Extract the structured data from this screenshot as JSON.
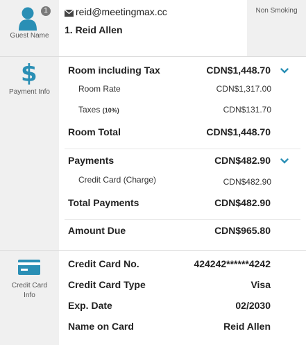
{
  "guest": {
    "section_label": "Guest Name",
    "badge_count": "1",
    "email": "reid@meetingmax.cc",
    "name_line": "1. Reid Allen",
    "preference": "Non Smoking",
    "icon": "user-icon"
  },
  "payment": {
    "section_label": "Payment Info",
    "icon": "dollar-icon",
    "room_including_tax_label": "Room including Tax",
    "room_including_tax_value": "CDN$1,448.70",
    "room_rate_label": "Room Rate",
    "room_rate_value": "CDN$1,317.00",
    "taxes_label": "Taxes",
    "taxes_pct": "(10%)",
    "taxes_value": "CDN$131.70",
    "room_total_label": "Room Total",
    "room_total_value": "CDN$1,448.70",
    "payments_label": "Payments",
    "payments_value": "CDN$482.90",
    "credit_card_charge_label": "Credit Card (Charge)",
    "credit_card_charge_value": "CDN$482.90",
    "total_payments_label": "Total Payments",
    "total_payments_value": "CDN$482.90",
    "amount_due_label": "Amount Due",
    "amount_due_value": "CDN$965.80"
  },
  "credit_card": {
    "section_label_line1": "Credit Card",
    "section_label_line2": "Info",
    "icon": "credit-card-icon",
    "number_label": "Credit Card No.",
    "number_value": "424242******4242",
    "type_label": "Credit Card Type",
    "type_value": "Visa",
    "exp_label": "Exp. Date",
    "exp_value": "02/2030",
    "name_label": "Name on Card",
    "name_value": "Reid Allen"
  },
  "colors": {
    "accent": "#2a8fb5",
    "badge": "#7a7a7a"
  }
}
